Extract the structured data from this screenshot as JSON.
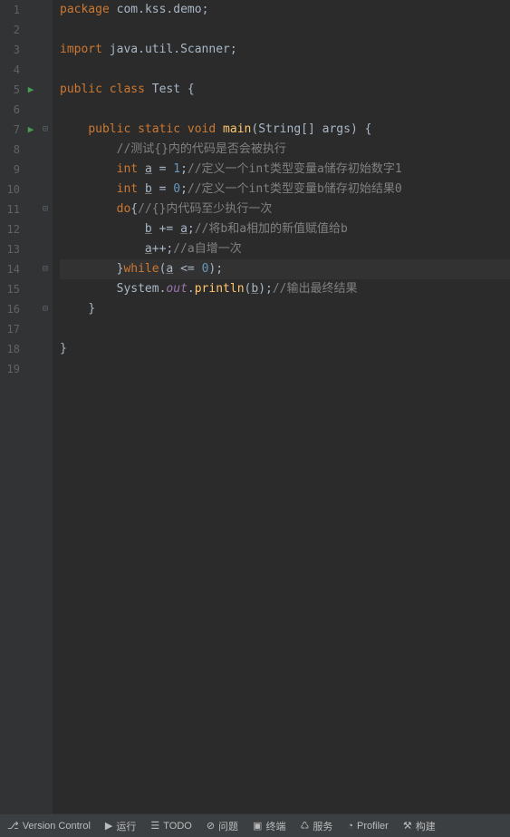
{
  "lines": [
    {
      "n": 1,
      "run": false,
      "fold": "",
      "html": "<span class='kw'>package</span> <span class='cls'>com</span><span class='op'>.</span><span class='cls'>kss</span><span class='op'>.</span><span class='cls'>demo</span><span class='op'>;</span>"
    },
    {
      "n": 2,
      "run": false,
      "fold": "",
      "html": ""
    },
    {
      "n": 3,
      "run": false,
      "fold": "",
      "html": "<span class='kw'>import</span> <span class='cls'>java</span><span class='op'>.</span><span class='cls'>util</span><span class='op'>.</span><span class='cls'>Scanner</span><span class='op'>;</span>"
    },
    {
      "n": 4,
      "run": false,
      "fold": "",
      "html": ""
    },
    {
      "n": 5,
      "run": true,
      "fold": "",
      "html": "<span class='kw'>public</span> <span class='kw'>class</span> <span class='cls'>Test</span> <span class='op'>{</span>"
    },
    {
      "n": 6,
      "run": false,
      "fold": "",
      "html": ""
    },
    {
      "n": 7,
      "run": true,
      "fold": "⊟",
      "html": "    <span class='kw'>public</span> <span class='kw'>static</span> <span class='kw'>void</span> <span class='mth'>main</span><span class='op'>(</span><span class='cls'>String</span><span class='op'>[]</span> <span class='cls'>args</span><span class='op'>)</span> <span class='op'>{</span>"
    },
    {
      "n": 8,
      "run": false,
      "fold": "",
      "html": "        <span class='cmt'>//测试{}内的代码是否会被执行</span>"
    },
    {
      "n": 9,
      "run": false,
      "fold": "",
      "html": "        <span class='kw'>int</span> <span class='var'>a</span> <span class='op'>=</span> <span class='num'>1</span><span class='op'>;</span><span class='cmt'>//定义一个int类型变量a储存初始数字1</span>"
    },
    {
      "n": 10,
      "run": false,
      "fold": "",
      "html": "        <span class='kw'>int</span> <span class='var'>b</span> <span class='op'>=</span> <span class='num'>0</span><span class='op'>;</span><span class='cmt'>//定义一个int类型变量b储存初始结果0</span>"
    },
    {
      "n": 11,
      "run": false,
      "fold": "⊟",
      "html": "        <span class='kw'>do</span><span class='op'>{</span><span class='cmt'>//{}内代码至少执行一次</span>"
    },
    {
      "n": 12,
      "run": false,
      "fold": "",
      "html": "            <span class='var'>b</span> <span class='op'>+=</span> <span class='var'>a</span><span class='op'>;</span><span class='cmt'>//将b和a相加的新值赋值给b</span>"
    },
    {
      "n": 13,
      "run": false,
      "fold": "",
      "html": "            <span class='var'>a</span><span class='op'>++;</span><span class='cmt'>//a自增一次</span>"
    },
    {
      "n": 14,
      "run": false,
      "fold": "⊟",
      "current": true,
      "html": "        <span class='op'>}</span><span class='kw'>while</span><span class='op'>(</span><span class='var'>a</span> <span class='op'>&lt;=</span> <span class='num'>0</span><span class='op'>);</span>"
    },
    {
      "n": 15,
      "run": false,
      "fold": "",
      "html": "        <span class='cls'>System</span><span class='op'>.</span><span class='fld'>out</span><span class='op'>.</span><span class='mth'>println</span><span class='op'>(</span><span class='var'>b</span><span class='op'>);</span><span class='cmt'>//输出最终结果</span>"
    },
    {
      "n": 16,
      "run": false,
      "fold": "⊟",
      "html": "    <span class='op'>}</span>"
    },
    {
      "n": 17,
      "run": false,
      "fold": "",
      "html": ""
    },
    {
      "n": 18,
      "run": false,
      "fold": "",
      "html": "<span class='op'>}</span>"
    },
    {
      "n": 19,
      "run": false,
      "fold": "",
      "html": ""
    }
  ],
  "bottom": {
    "vcs": "Version Control",
    "run": "运行",
    "todo": "TODO",
    "problems": "问题",
    "terminal": "终端",
    "services": "服务",
    "profiler": "Profiler",
    "build": "构建"
  }
}
